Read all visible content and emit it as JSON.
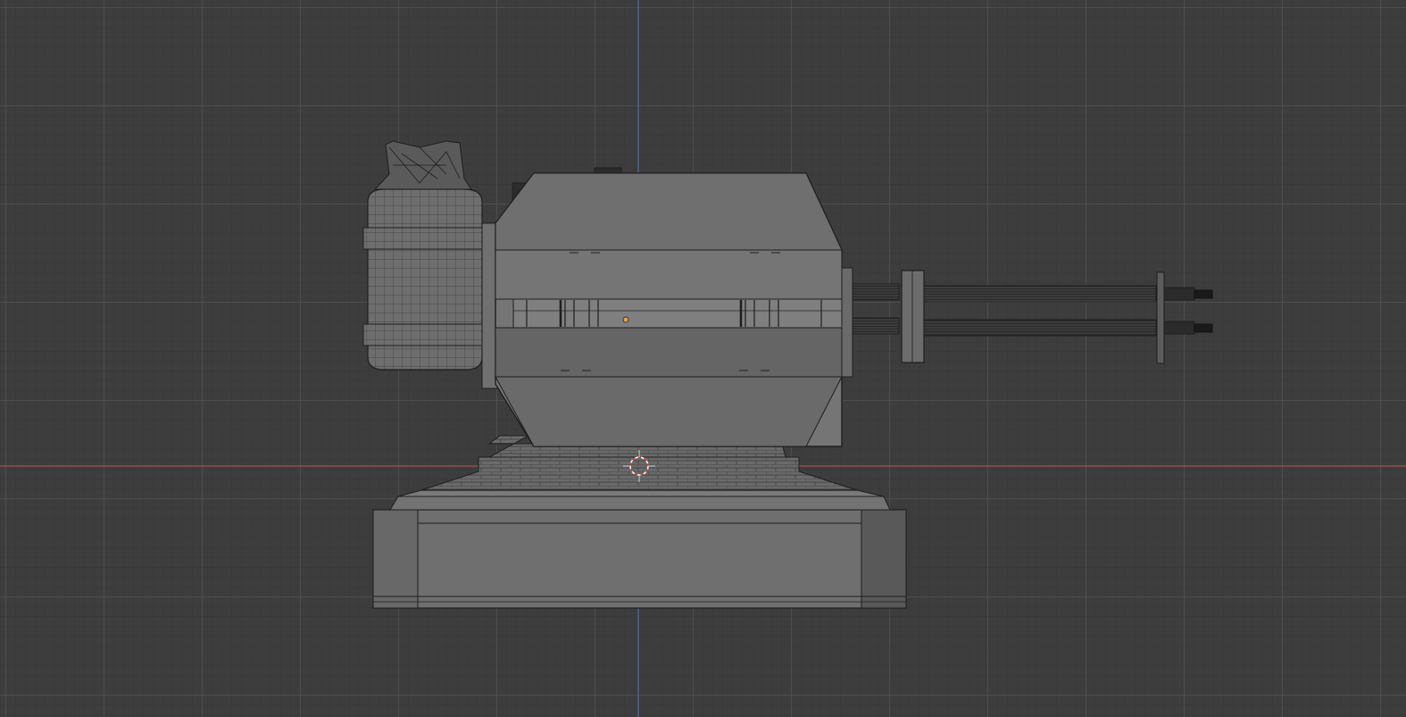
{
  "viewport": {
    "grid_color": "#505050",
    "background_color": "#3d3d3d",
    "x_axis_color": "#b04a4a",
    "y_axis_color": "#3f6fb5",
    "mesh_face_color": "#777777",
    "mesh_wire_color": "#1e1e1e",
    "origin_point_color": "#e6a23c",
    "cursor_color": "#ffffff"
  }
}
